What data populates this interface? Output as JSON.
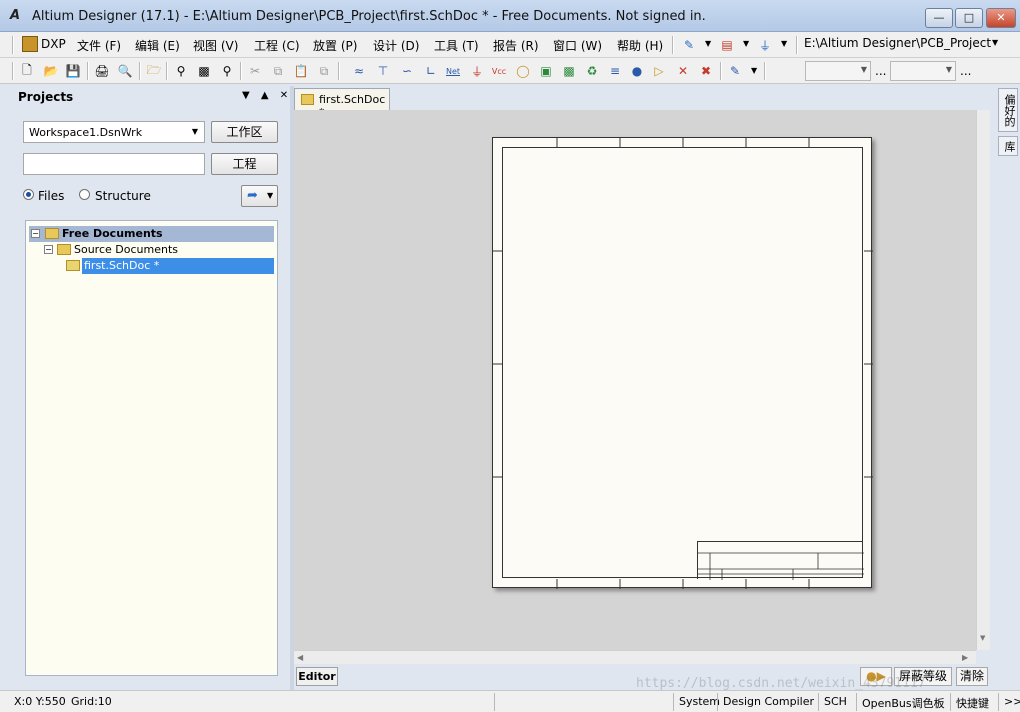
{
  "window": {
    "title": "Altium Designer (17.1) - E:\\Altium Designer\\PCB_Project\\first.SchDoc * - Free Documents. Not signed in.",
    "logo_text": "A"
  },
  "menubar": {
    "items": [
      "DXP",
      "文件 (F)",
      "编辑 (E)",
      "视图 (V)",
      "工程 (C)",
      "放置 (P)",
      "设计 (D)",
      "工具 (T)",
      "报告 (R)",
      "窗口 (W)",
      "帮助 (H)"
    ],
    "path": "E:\\Altium Designer\\PCB_Project"
  },
  "toolbar": {
    "net_label": "Net",
    "vcc_label": "Vcc",
    "more_1": "...",
    "more_2": "..."
  },
  "projects_panel": {
    "title": "Projects",
    "workspace_value": "Workspace1.DsnWrk",
    "workspace_button": "工作区",
    "project_button": "工程",
    "radio_files": "Files",
    "radio_structure": "Structure",
    "tree": {
      "root": "Free Documents",
      "group": "Source Documents",
      "file": "first.SchDoc *"
    }
  },
  "document": {
    "tab_label": "first.SchDoc *",
    "editor_tab": "Editor",
    "mask_level": "屏蔽等级",
    "clear": "清除"
  },
  "right_panel": {
    "tab1": "偏好的",
    "tab2": "库"
  },
  "statusbar": {
    "coords": "X:0 Y:550",
    "grid": "Grid:10",
    "buttons": [
      "System",
      "Design Compiler",
      "SCH",
      "OpenBus调色板",
      "快捷键",
      ">>"
    ],
    "watermark": "https://blog.csdn.net/weixin_43791117"
  }
}
